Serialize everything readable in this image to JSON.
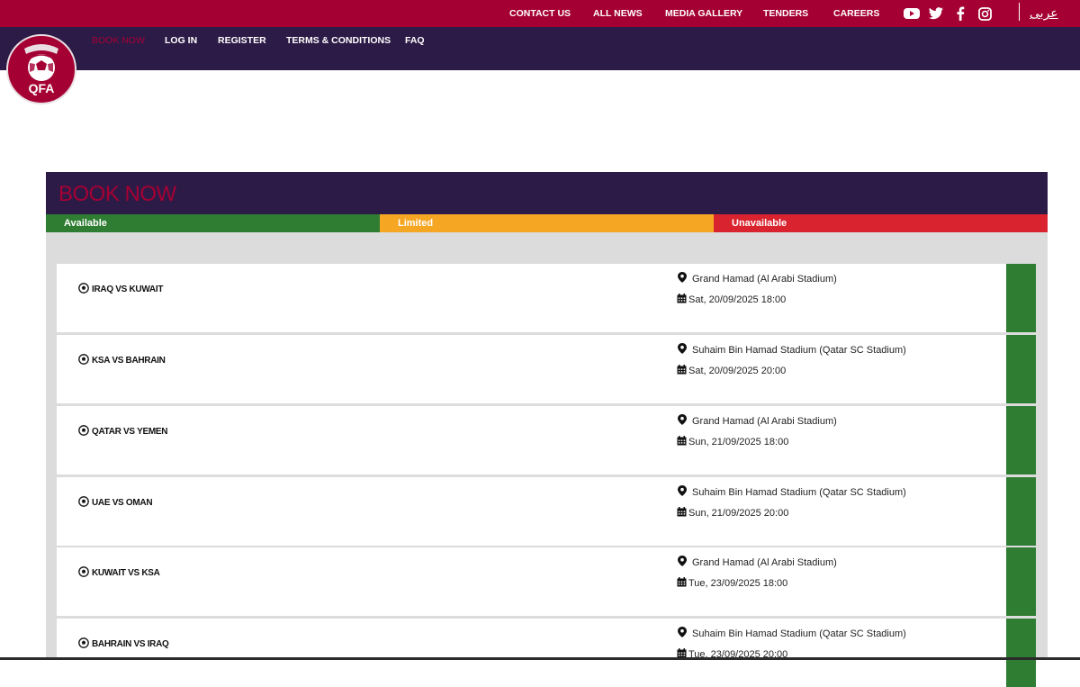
{
  "topbar": {
    "links": [
      "CONTACT US",
      "ALL NEWS",
      "MEDIA GALLERY",
      "TENDERS",
      "CAREERS"
    ],
    "social_icons": [
      "youtube-icon",
      "twitter-icon",
      "facebook-icon",
      "instagram-icon"
    ],
    "language": "عربى"
  },
  "mainnav": {
    "items": [
      "BOOK NOW",
      "LOG IN",
      "REGISTER",
      "TERMS & CONDITIONS",
      "FAQ"
    ]
  },
  "logo": {
    "text": "QFA"
  },
  "booking": {
    "title": "BOOK NOW",
    "legend": [
      "Available",
      "Limited",
      "Unavailable"
    ]
  },
  "matches": [
    {
      "teams": "IRAQ VS KUWAIT",
      "venue": "Grand Hamad (Al Arabi Stadium)",
      "datetime": "Sat, 20/09/2025 18:00",
      "status": "Available"
    },
    {
      "teams": "KSA VS BAHRAIN",
      "venue": "Suhaim Bin Hamad Stadium (Qatar SC Stadium)",
      "datetime": "Sat, 20/09/2025 20:00",
      "status": "Available"
    },
    {
      "teams": "QATAR VS YEMEN",
      "venue": "Grand Hamad (Al Arabi Stadium)",
      "datetime": "Sun, 21/09/2025 18:00",
      "status": "Available"
    },
    {
      "teams": "UAE VS OMAN",
      "venue": "Suhaim Bin Hamad Stadium (Qatar SC Stadium)",
      "datetime": "Sun, 21/09/2025 20:00",
      "status": "Available"
    },
    {
      "teams": "KUWAIT VS KSA",
      "venue": "Grand Hamad (Al Arabi Stadium)",
      "datetime": "Tue, 23/09/2025 18:00",
      "status": "Available"
    },
    {
      "teams": "BAHRAIN VS IRAQ",
      "venue": "Suhaim Bin Hamad Stadium (Qatar SC Stadium)",
      "datetime": "Tue, 23/09/2025 20:00",
      "status": "Available"
    }
  ],
  "colors": {
    "brand_maroon": "#a50034",
    "nav_purple": "#2d1b47",
    "available": "#2e7d32",
    "limited": "#f5a623",
    "unavailable": "#d9232e"
  }
}
